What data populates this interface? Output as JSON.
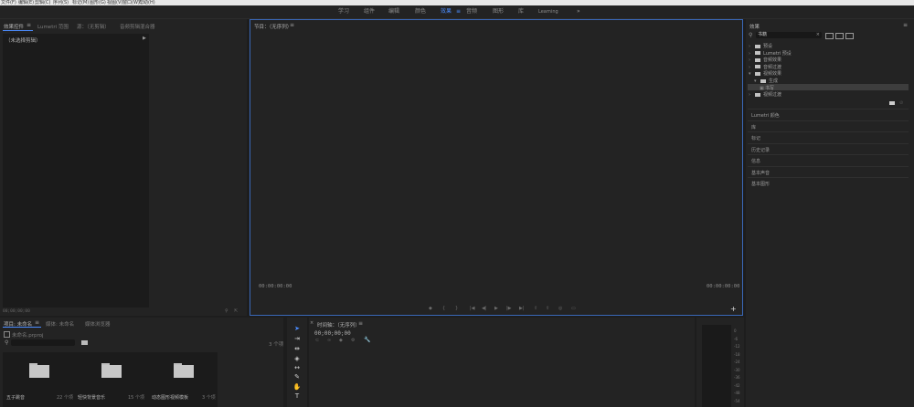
{
  "menubar": [
    "文件(F)",
    "编辑(E)",
    "剪辑(C)",
    "序列(S)",
    "标记(M)",
    "图形(G)",
    "视图(V)",
    "窗口(W)",
    "帮助(H)"
  ],
  "workspaces": [
    {
      "label": "学习",
      "active": false
    },
    {
      "label": "组件",
      "active": false
    },
    {
      "label": "编辑",
      "active": false
    },
    {
      "label": "颜色",
      "active": false
    },
    {
      "label": "效果",
      "active": true
    },
    {
      "label": "音频",
      "active": false
    },
    {
      "label": "图形",
      "active": false
    },
    {
      "label": "库",
      "active": false
    },
    {
      "label": "Learning",
      "active": false
    }
  ],
  "source_panel": {
    "tabs": [
      "效果控件",
      "Lumetri 范围",
      "源：（无剪辑）",
      "音频剪辑混合器"
    ],
    "no_clip": "（未选择剪辑）",
    "timecode": "00;00;00;00"
  },
  "program_monitor": {
    "title": "节目：（无序列）",
    "tc_left": "00:00:00:00",
    "tc_right": "00:00:00:00"
  },
  "effects_panel": {
    "title": "效果",
    "search_value": "书籍",
    "tree": [
      {
        "label": "预设",
        "indent": 0,
        "selected": false
      },
      {
        "label": "Lumetri 预设",
        "indent": 0,
        "selected": false
      },
      {
        "label": "音频效果",
        "indent": 0,
        "selected": false
      },
      {
        "label": "音频过渡",
        "indent": 0,
        "selected": false
      },
      {
        "label": "视频效果",
        "indent": 0,
        "selected": false
      },
      {
        "label": "生成",
        "indent": 1,
        "selected": false
      },
      {
        "label": "书写",
        "indent": 2,
        "selected": true
      },
      {
        "label": "视频过渡",
        "indent": 0,
        "selected": false
      }
    ],
    "sections": [
      "Lumetri 颜色",
      "库",
      "标记",
      "历史记录",
      "信息",
      "基本声音",
      "基本图形"
    ]
  },
  "project_panel": {
    "tabs": [
      "项目: 未命名",
      "媒体: 未命名",
      "媒体浏览器"
    ],
    "project_name": "未命名.prproj",
    "item_count": "3 个项",
    "bins": [
      {
        "name": "五子跳音",
        "count": "22 个项"
      },
      {
        "name": "轻快背景音乐",
        "count": "15 个项"
      },
      {
        "name": "动态图形视频模板",
        "count": "3 个项"
      }
    ]
  },
  "timeline": {
    "title": "时间轴：（无序列）",
    "timecode": "00;00;00;00"
  },
  "meter_ticks": [
    "0",
    "-6",
    "-12",
    "-18",
    "-24",
    "-30",
    "-36",
    "-42",
    "-48",
    "-54"
  ]
}
